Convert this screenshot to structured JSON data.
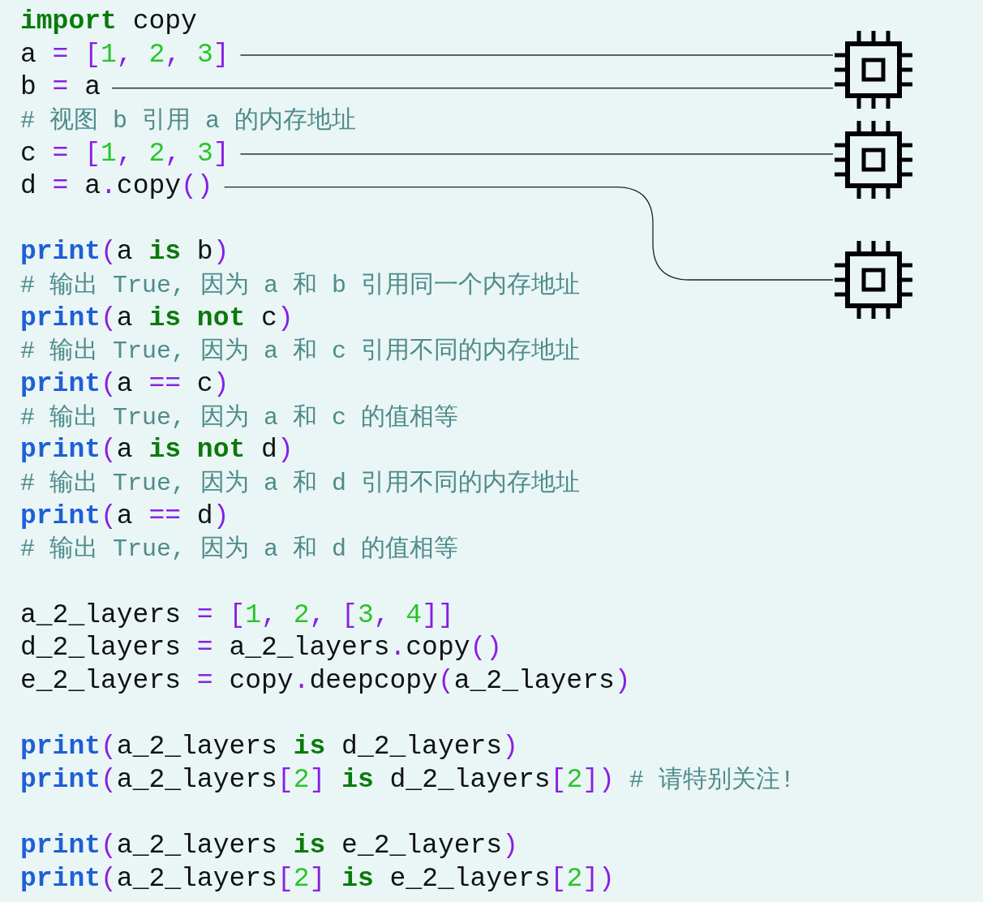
{
  "code_lines": [
    {
      "kind": "code",
      "tokens": [
        {
          "kind": "keyword",
          "text": "import"
        },
        {
          "kind": "plain",
          "text": " copy"
        }
      ]
    },
    {
      "kind": "code",
      "leader": true,
      "tokens": [
        {
          "kind": "plain",
          "text": "a "
        },
        {
          "kind": "operator",
          "text": "="
        },
        {
          "kind": "bracket",
          "text": " ["
        },
        {
          "kind": "number",
          "text": "1"
        },
        {
          "kind": "bracket",
          "text": ", "
        },
        {
          "kind": "number",
          "text": "2"
        },
        {
          "kind": "bracket",
          "text": ", "
        },
        {
          "kind": "number",
          "text": "3"
        },
        {
          "kind": "bracket",
          "text": "]"
        }
      ]
    },
    {
      "kind": "code",
      "leader": true,
      "tokens": [
        {
          "kind": "plain",
          "text": "b "
        },
        {
          "kind": "operator",
          "text": "="
        },
        {
          "kind": "plain",
          "text": " a"
        }
      ]
    },
    {
      "kind": "code",
      "tokens": [
        {
          "kind": "comment",
          "text": "# 视图 b 引用 a 的内存地址"
        }
      ]
    },
    {
      "kind": "code",
      "leader": true,
      "tokens": [
        {
          "kind": "plain",
          "text": "c "
        },
        {
          "kind": "operator",
          "text": "="
        },
        {
          "kind": "bracket",
          "text": " ["
        },
        {
          "kind": "number",
          "text": "1"
        },
        {
          "kind": "bracket",
          "text": ", "
        },
        {
          "kind": "number",
          "text": "2"
        },
        {
          "kind": "bracket",
          "text": ", "
        },
        {
          "kind": "number",
          "text": "3"
        },
        {
          "kind": "bracket",
          "text": "]"
        }
      ]
    },
    {
      "kind": "code",
      "leader": true,
      "tokens": [
        {
          "kind": "plain",
          "text": "d "
        },
        {
          "kind": "operator",
          "text": "="
        },
        {
          "kind": "plain",
          "text": " a"
        },
        {
          "kind": "operator",
          "text": "."
        },
        {
          "kind": "plain",
          "text": "copy"
        },
        {
          "kind": "bracket",
          "text": "()"
        }
      ]
    },
    {
      "kind": "blank"
    },
    {
      "kind": "code",
      "tokens": [
        {
          "kind": "builtin",
          "text": "print"
        },
        {
          "kind": "bracket",
          "text": "("
        },
        {
          "kind": "plain",
          "text": "a "
        },
        {
          "kind": "keyword",
          "text": "is"
        },
        {
          "kind": "plain",
          "text": " b"
        },
        {
          "kind": "bracket",
          "text": ")"
        }
      ]
    },
    {
      "kind": "code",
      "tokens": [
        {
          "kind": "comment",
          "text": "# 输出 True, 因为 a 和 b 引用同一个内存地址"
        }
      ]
    },
    {
      "kind": "code",
      "tokens": [
        {
          "kind": "builtin",
          "text": "print"
        },
        {
          "kind": "bracket",
          "text": "("
        },
        {
          "kind": "plain",
          "text": "a "
        },
        {
          "kind": "keyword",
          "text": "is not"
        },
        {
          "kind": "plain",
          "text": " c"
        },
        {
          "kind": "bracket",
          "text": ")"
        }
      ]
    },
    {
      "kind": "code",
      "tokens": [
        {
          "kind": "comment",
          "text": "# 输出 True, 因为 a 和 c 引用不同的内存地址"
        }
      ]
    },
    {
      "kind": "code",
      "tokens": [
        {
          "kind": "builtin",
          "text": "print"
        },
        {
          "kind": "bracket",
          "text": "("
        },
        {
          "kind": "plain",
          "text": "a "
        },
        {
          "kind": "operator",
          "text": "=="
        },
        {
          "kind": "plain",
          "text": " c"
        },
        {
          "kind": "bracket",
          "text": ")"
        }
      ]
    },
    {
      "kind": "code",
      "tokens": [
        {
          "kind": "comment",
          "text": "# 输出 True, 因为 a 和 c 的值相等"
        }
      ]
    },
    {
      "kind": "code",
      "tokens": [
        {
          "kind": "builtin",
          "text": "print"
        },
        {
          "kind": "bracket",
          "text": "("
        },
        {
          "kind": "plain",
          "text": "a "
        },
        {
          "kind": "keyword",
          "text": "is not"
        },
        {
          "kind": "plain",
          "text": " d"
        },
        {
          "kind": "bracket",
          "text": ")"
        }
      ]
    },
    {
      "kind": "code",
      "tokens": [
        {
          "kind": "comment",
          "text": "# 输出 True, 因为 a 和 d 引用不同的内存地址"
        }
      ]
    },
    {
      "kind": "code",
      "tokens": [
        {
          "kind": "builtin",
          "text": "print"
        },
        {
          "kind": "bracket",
          "text": "("
        },
        {
          "kind": "plain",
          "text": "a "
        },
        {
          "kind": "operator",
          "text": "=="
        },
        {
          "kind": "plain",
          "text": " d"
        },
        {
          "kind": "bracket",
          "text": ")"
        }
      ]
    },
    {
      "kind": "code",
      "tokens": [
        {
          "kind": "comment",
          "text": "# 输出 True, 因为 a 和 d 的值相等"
        }
      ]
    },
    {
      "kind": "blank"
    },
    {
      "kind": "code",
      "tokens": [
        {
          "kind": "plain",
          "text": "a_2_layers "
        },
        {
          "kind": "operator",
          "text": "="
        },
        {
          "kind": "bracket",
          "text": " ["
        },
        {
          "kind": "number",
          "text": "1"
        },
        {
          "kind": "bracket",
          "text": ", "
        },
        {
          "kind": "number",
          "text": "2"
        },
        {
          "kind": "bracket",
          "text": ", ["
        },
        {
          "kind": "number",
          "text": "3"
        },
        {
          "kind": "bracket",
          "text": ", "
        },
        {
          "kind": "number",
          "text": "4"
        },
        {
          "kind": "bracket",
          "text": "]]"
        }
      ]
    },
    {
      "kind": "code",
      "tokens": [
        {
          "kind": "plain",
          "text": "d_2_layers "
        },
        {
          "kind": "operator",
          "text": "="
        },
        {
          "kind": "plain",
          "text": " a_2_layers"
        },
        {
          "kind": "operator",
          "text": "."
        },
        {
          "kind": "plain",
          "text": "copy"
        },
        {
          "kind": "bracket",
          "text": "()"
        }
      ]
    },
    {
      "kind": "code",
      "tokens": [
        {
          "kind": "plain",
          "text": "e_2_layers "
        },
        {
          "kind": "operator",
          "text": "="
        },
        {
          "kind": "plain",
          "text": " copy"
        },
        {
          "kind": "operator",
          "text": "."
        },
        {
          "kind": "plain",
          "text": "deepcopy"
        },
        {
          "kind": "bracket",
          "text": "("
        },
        {
          "kind": "plain",
          "text": "a_2_layers"
        },
        {
          "kind": "bracket",
          "text": ")"
        }
      ]
    },
    {
      "kind": "blank"
    },
    {
      "kind": "code",
      "tokens": [
        {
          "kind": "builtin",
          "text": "print"
        },
        {
          "kind": "bracket",
          "text": "("
        },
        {
          "kind": "plain",
          "text": "a_2_layers "
        },
        {
          "kind": "keyword",
          "text": "is"
        },
        {
          "kind": "plain",
          "text": " d_2_layers"
        },
        {
          "kind": "bracket",
          "text": ")"
        }
      ]
    },
    {
      "kind": "code",
      "tokens": [
        {
          "kind": "builtin",
          "text": "print"
        },
        {
          "kind": "bracket",
          "text": "("
        },
        {
          "kind": "plain",
          "text": "a_2_layers"
        },
        {
          "kind": "bracket",
          "text": "["
        },
        {
          "kind": "number",
          "text": "2"
        },
        {
          "kind": "bracket",
          "text": "]"
        },
        {
          "kind": "keyword",
          "text": " is"
        },
        {
          "kind": "plain",
          "text": " d_2_layers"
        },
        {
          "kind": "bracket",
          "text": "["
        },
        {
          "kind": "number",
          "text": "2"
        },
        {
          "kind": "bracket",
          "text": "])"
        },
        {
          "kind": "comment",
          "text": " # 请特别关注!"
        }
      ]
    },
    {
      "kind": "blank"
    },
    {
      "kind": "code",
      "tokens": [
        {
          "kind": "builtin",
          "text": "print"
        },
        {
          "kind": "bracket",
          "text": "("
        },
        {
          "kind": "plain",
          "text": "a_2_layers "
        },
        {
          "kind": "keyword",
          "text": "is"
        },
        {
          "kind": "plain",
          "text": " e_2_layers"
        },
        {
          "kind": "bracket",
          "text": ")"
        }
      ]
    },
    {
      "kind": "code",
      "tokens": [
        {
          "kind": "builtin",
          "text": "print"
        },
        {
          "kind": "bracket",
          "text": "("
        },
        {
          "kind": "plain",
          "text": "a_2_layers"
        },
        {
          "kind": "bracket",
          "text": "["
        },
        {
          "kind": "number",
          "text": "2"
        },
        {
          "kind": "bracket",
          "text": "]"
        },
        {
          "kind": "keyword",
          "text": " is"
        },
        {
          "kind": "plain",
          "text": " e_2_layers"
        },
        {
          "kind": "bracket",
          "text": "["
        },
        {
          "kind": "number",
          "text": "2"
        },
        {
          "kind": "bracket",
          "text": "])"
        }
      ]
    }
  ]
}
